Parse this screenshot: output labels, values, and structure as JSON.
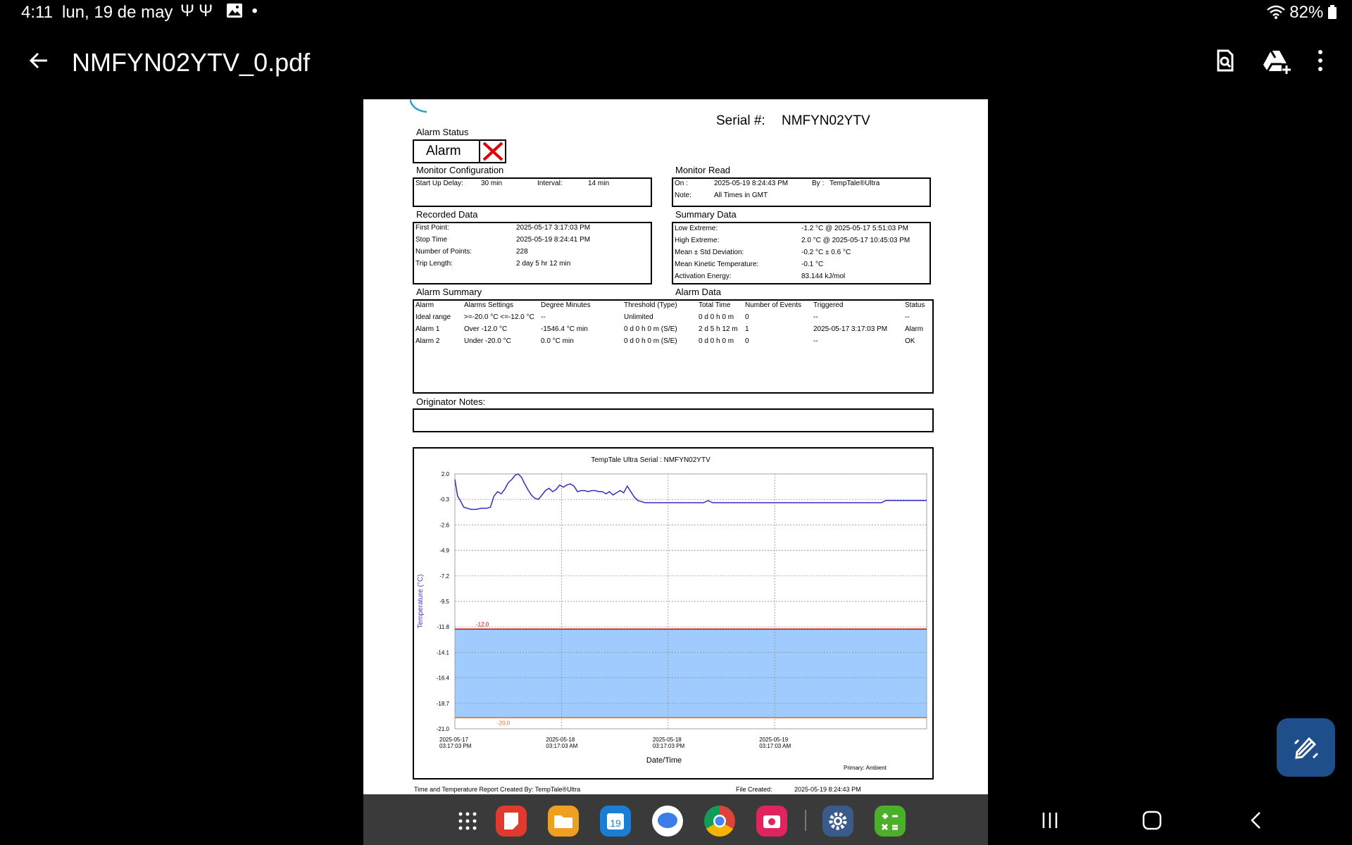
{
  "status_bar": {
    "time": "4:11",
    "date": "lun, 19 de may",
    "battery": "82%"
  },
  "app_bar": {
    "title": "NMFYN02YTV_0.pdf"
  },
  "report": {
    "serial_label": "Serial #:",
    "serial_value": "NMFYN02YTV",
    "alarm_status_label": "Alarm Status",
    "alarm_status_value": "Alarm",
    "monitor_config": {
      "label": "Monitor Configuration",
      "startup_delay_label": "Start Up Delay:",
      "startup_delay_value": "30 min",
      "interval_label": "Interval:",
      "interval_value": "14 min"
    },
    "monitor_read": {
      "label": "Monitor Read",
      "on_label": "On :",
      "on_value": "2025-05-19  8:24:43 PM",
      "by_label": "By :",
      "by_value": "TempTale®Ultra",
      "note_label": "Note:",
      "note_value": "All Times in GMT"
    },
    "recorded_data": {
      "label": "Recorded Data",
      "rows": [
        {
          "k": "First Point:",
          "v": "2025-05-17  3:17:03 PM"
        },
        {
          "k": "Stop Time",
          "v": "2025-05-19  8:24:41 PM"
        },
        {
          "k": "Number of Points:",
          "v": "228"
        },
        {
          "k": "Trip Length:",
          "v": "2 day 5 hr 12 min"
        }
      ]
    },
    "summary_data": {
      "label": "Summary Data",
      "rows": [
        {
          "k": "Low Extreme:",
          "v": "-1.2 °C @ 2025-05-17  5:51:03 PM"
        },
        {
          "k": "High Extreme:",
          "v": "2.0 °C @ 2025-05-17 10:45:03 PM"
        },
        {
          "k": "Mean ± Std Deviation:",
          "v": "-0.2 °C ± 0.6 °C"
        },
        {
          "k": "Mean Kinetic Temperature:",
          "v": "-0.1 °C"
        },
        {
          "k": "Activation Energy:",
          "v": "83.144 kJ/mol"
        }
      ]
    },
    "alarm_summary_label": "Alarm Summary",
    "alarm_data_label": "Alarm Data",
    "alarm_table": {
      "headers": [
        "Alarm",
        "Alarms Settings",
        "Degree Minutes",
        "Threshold (Type)",
        "Total Time",
        "Number of Events",
        "Triggered",
        "Status"
      ],
      "rows": [
        [
          "Ideal range",
          ">=-20.0 °C <=-12.0 °C",
          "--",
          "Unlimited",
          "0 d 0 h 0 m",
          "0",
          "--",
          "--"
        ],
        [
          "Alarm 1",
          "Over -12.0 °C",
          "-1546.4 °C min",
          "0 d 0 h 0 m (S/E)",
          "2 d 5 h 12 m",
          "1",
          "2025-05-17  3:17:03 PM",
          "Alarm"
        ],
        [
          "Alarm 2",
          "Under -20.0 °C",
          "0.0 °C min",
          "0 d 0 h 0 m (S/E)",
          "0 d 0 h 0 m",
          "0",
          "--",
          "OK"
        ]
      ]
    },
    "originator_notes_label": "Originator Notes:",
    "footer_left": "Time and Temperature Report Created By:  TempTale®Ultra",
    "footer_file_label": "File Created:",
    "footer_file_value": "2025-05-19  8:24:43 PM"
  },
  "chart_data": {
    "type": "line",
    "title": "TempTale Ultra  Serial : NMFYN02YTV",
    "xlabel": "Date/Time",
    "ylabel": "Temperature   (°C)",
    "note": "Primary: Ambient",
    "y_ticks": [
      "2.0",
      "-0.3",
      "-2.6",
      "-4.9",
      "-7.2",
      "-9.5",
      "-11.8",
      "-14.1",
      "-16.4",
      "-18.7",
      "-21.0"
    ],
    "ylim": [
      -21.0,
      2.0
    ],
    "x_ticks": [
      {
        "date": "2025-05-17",
        "time": "03:17:03 PM"
      },
      {
        "date": "2025-05-18",
        "time": "03:17:03 AM"
      },
      {
        "date": "2025-05-18",
        "time": "03:17:03 PM"
      },
      {
        "date": "2025-05-19",
        "time": "03:17:03 AM"
      }
    ],
    "xlim_hours": [
      0,
      53.1
    ],
    "upper_limit": {
      "value": -12.0,
      "label": "-12.0",
      "color": "#c00000"
    },
    "lower_limit": {
      "value": -20.0,
      "label": "-20.0",
      "color": "#e07020"
    },
    "band_color": "#9fcbff",
    "line_color": "#3030c0",
    "series": [
      {
        "x": [
          0,
          0.3,
          0.6,
          1.0,
          1.4,
          1.8,
          2.4,
          3.0,
          3.6,
          4.0,
          4.4,
          4.8,
          5.2,
          5.6,
          6.0,
          6.4,
          6.8,
          7.1,
          7.5,
          7.8,
          8.2,
          8.6,
          9.0,
          9.4,
          9.8,
          10.2,
          10.6,
          11.0,
          11.4,
          11.8,
          12.2,
          12.6,
          13.0,
          13.4,
          13.8,
          14.2,
          14.6,
          15.0,
          15.4,
          15.8,
          16.2,
          16.6,
          17.0,
          17.4,
          17.8,
          18.2,
          18.6,
          19.0,
          19.4,
          19.8,
          20.2,
          20.6,
          21.0,
          21.4,
          21.8,
          22.2,
          22.6,
          23.0,
          23.4,
          23.8,
          24.2,
          25.0,
          26.0,
          27.0,
          28.0,
          28.5,
          29.0,
          30.0,
          31.0,
          33.0,
          35.0,
          37.0,
          39.0,
          41.0,
          43.0,
          45.0,
          47.0,
          48.0,
          48.5,
          50.0,
          52.0,
          53.1
        ],
        "y": [
          1.5,
          0.0,
          -0.4,
          -1.0,
          -1.1,
          -1.2,
          -1.2,
          -1.1,
          -1.1,
          -1.0,
          0.0,
          0.4,
          0.2,
          0.6,
          1.2,
          1.5,
          1.9,
          2.0,
          1.7,
          1.2,
          0.6,
          0.1,
          -0.2,
          -0.3,
          0.1,
          0.5,
          0.7,
          0.4,
          0.6,
          1.0,
          0.8,
          1.0,
          1.1,
          0.9,
          0.4,
          0.5,
          0.5,
          0.4,
          0.5,
          0.5,
          0.4,
          0.4,
          0.2,
          0.4,
          0.1,
          0.3,
          0.5,
          0.3,
          0.9,
          0.4,
          -0.1,
          -0.4,
          -0.5,
          -0.6,
          -0.6,
          -0.6,
          -0.6,
          -0.6,
          -0.6,
          -0.6,
          -0.6,
          -0.6,
          -0.6,
          -0.6,
          -0.6,
          -0.4,
          -0.6,
          -0.6,
          -0.6,
          -0.6,
          -0.6,
          -0.6,
          -0.6,
          -0.6,
          -0.6,
          -0.6,
          -0.6,
          -0.6,
          -0.4,
          -0.4,
          -0.4,
          -0.4
        ]
      }
    ]
  }
}
